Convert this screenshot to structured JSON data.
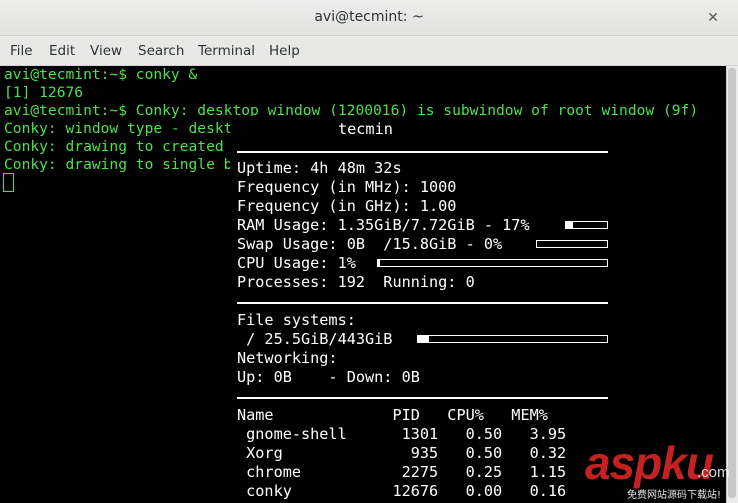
{
  "window": {
    "title": "avi@tecmint: ~",
    "close_glyph": "✕"
  },
  "menu": {
    "items": [
      "File",
      "Edit",
      "View",
      "Search",
      "Terminal",
      "Help"
    ]
  },
  "terminal": {
    "lines": [
      "avi@tecmint:~$ conky &",
      "[1] 12676",
      "avi@tecmint:~$ Conky: desktop window (1200016) is subwindow of root window (9f)",
      "Conky: window type - deskt",
      "Conky: drawing to created ",
      "Conky: drawing to single b"
    ]
  },
  "conky": {
    "hostname": "tecmin",
    "uptime": "Uptime: 4h 48m 32s",
    "freq_mhz": "Frequency (in MHz): 1000",
    "freq_ghz": "Frequency (in GHz): 1.00",
    "ram": "RAM Usage: 1.35GiB/7.72GiB - 17%",
    "ram_pct": 17,
    "swap": "Swap Usage: 0B  /15.8GiB - 0%",
    "swap_pct": 0,
    "cpu": "CPU Usage: 1%",
    "cpu_pct": 1,
    "processes": "Processes: 192  Running: 0",
    "fs_header": "File systems:",
    "fs_root": " / 25.5GiB/443GiB",
    "fs_pct": 6,
    "net_header": "Networking:",
    "net_line": "Up: 0B    - Down: 0B",
    "proc_header": "Name             PID   CPU%   MEM%",
    "procs": [
      " gnome-shell      1301   0.50   3.95",
      " Xorg              935   0.50   0.32",
      " chrome           2275   0.25   1.15",
      " conky           12676   0.00   0.16"
    ]
  },
  "watermark": {
    "main": "aspku",
    "com": ".com",
    "sub": "免费网站源码下载站!"
  }
}
